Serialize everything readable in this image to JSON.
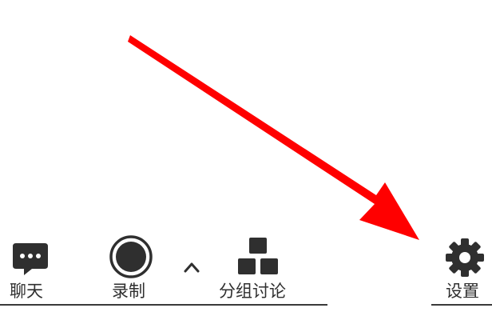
{
  "toolbar": {
    "items": [
      {
        "id": "chat",
        "label": "聊天",
        "icon": "chat-bubble-icon"
      },
      {
        "id": "record",
        "label": "录制",
        "icon": "record-icon"
      },
      {
        "id": "breakout",
        "label": "分组讨论",
        "icon": "breakout-rooms-icon"
      },
      {
        "id": "settings",
        "label": "设置",
        "icon": "gear-icon"
      }
    ],
    "record_options_icon": "chevron-up-icon"
  },
  "annotation": {
    "icon": "red-arrow-icon",
    "color": "#ff0000",
    "target": "settings"
  },
  "colors": {
    "icon": "#2f2f2f",
    "text": "#2f2f2f",
    "background": "#ffffff"
  }
}
